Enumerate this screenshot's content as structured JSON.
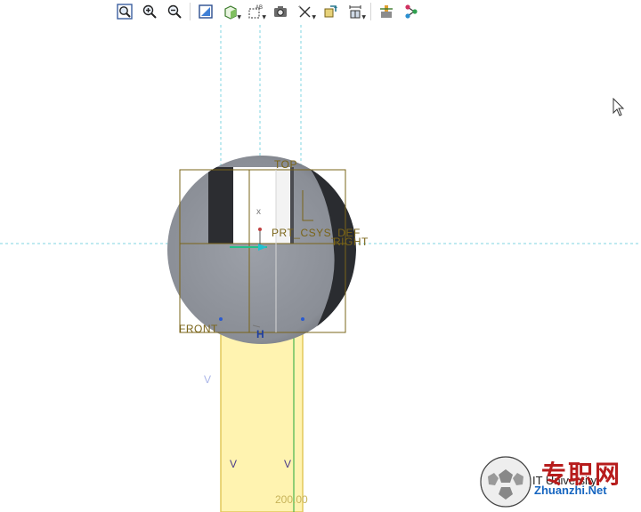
{
  "toolbar": {
    "items": [
      {
        "name": "refit",
        "icon": "zoom-fit-icon"
      },
      {
        "name": "zoom-in",
        "icon": "zoom-in-icon"
      },
      {
        "name": "zoom-out",
        "icon": "zoom-out-icon"
      },
      {
        "name": "repaint",
        "icon": "repaint-icon"
      },
      {
        "name": "display-style",
        "icon": "display-style-icon"
      },
      {
        "name": "datum-display",
        "icon": "datum-display-icon",
        "badge": "AB"
      },
      {
        "name": "saved-views",
        "icon": "saved-views-icon"
      },
      {
        "name": "constraint-display",
        "icon": "constraint-display-icon"
      },
      {
        "name": "sketch-setup",
        "icon": "sketch-setup-icon"
      },
      {
        "name": "dimension-display",
        "icon": "dimension-display-icon"
      },
      {
        "name": "palette",
        "icon": "palette-icon"
      },
      {
        "name": "references",
        "icon": "references-icon"
      }
    ]
  },
  "viewport": {
    "labels": {
      "top": "TOP",
      "csys": "PRT_CSYS_DEF",
      "right": "RIGHT",
      "front": "FRONT",
      "axis_x": "x",
      "constraint_h": "H",
      "constraint_v": "V"
    },
    "dimension": "200.00"
  },
  "watermark": {
    "cn": "专职网",
    "en": "Zhuanzhi.Net",
    "partial": "IT University"
  },
  "colors": {
    "datum_plane": "#7a6418",
    "sketch_highlight": "#fff2a8",
    "body_gray": "#8e929a",
    "axis_dash": "#7fd6e0"
  }
}
